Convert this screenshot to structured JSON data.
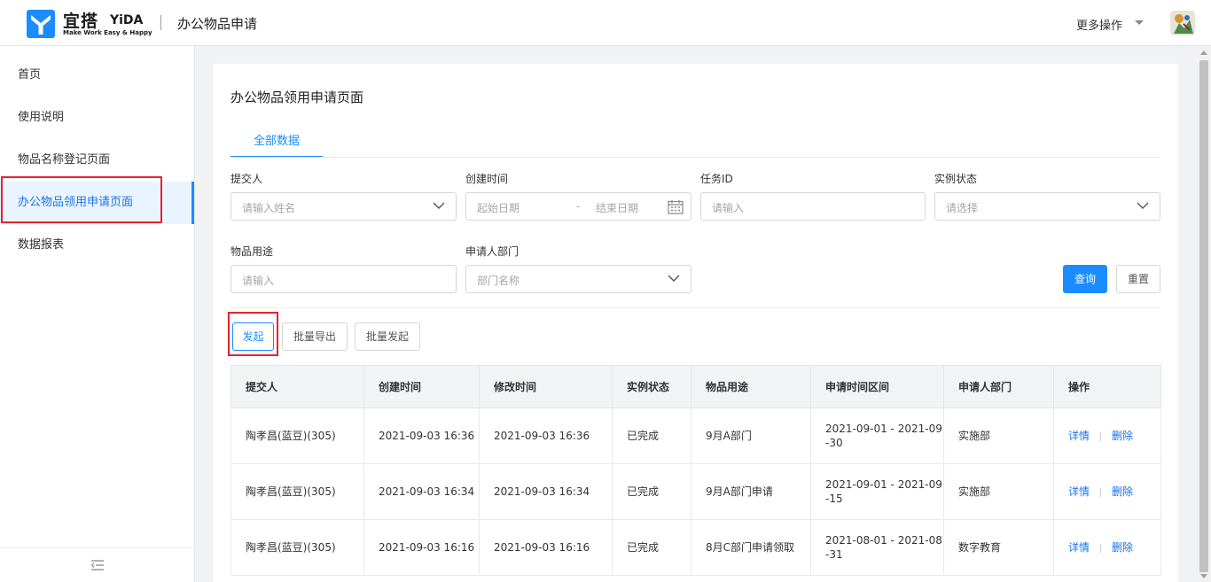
{
  "header": {
    "logo_cn": "宜搭",
    "logo_en": "YiDA",
    "logo_sub": "Make Work Easy & Happy",
    "app_title": "办公物品申请",
    "more_ops": "更多操作"
  },
  "sidebar": {
    "items": [
      {
        "label": "首页"
      },
      {
        "label": "使用说明"
      },
      {
        "label": "物品名称登记页面"
      },
      {
        "label": "办公物品领用申请页面"
      },
      {
        "label": "数据报表"
      }
    ]
  },
  "main": {
    "page_title": "办公物品领用申请页面",
    "tab_all": "全部数据"
  },
  "filters": {
    "submitter": {
      "label": "提交人",
      "placeholder": "请输入姓名"
    },
    "created": {
      "label": "创建时间",
      "start": "起始日期",
      "dash": "-",
      "end": "结束日期"
    },
    "task_id": {
      "label": "任务ID",
      "placeholder": "请输入"
    },
    "status": {
      "label": "实例状态",
      "placeholder": "请选择"
    },
    "purpose": {
      "label": "物品用途",
      "placeholder": "请输入"
    },
    "dept": {
      "label": "申请人部门",
      "placeholder": "部门名称"
    },
    "query_btn": "查询",
    "reset_btn": "重置"
  },
  "actions": {
    "launch": "发起",
    "batch_export": "批量导出",
    "batch_launch": "批量发起"
  },
  "table": {
    "headers": [
      "提交人",
      "创建时间",
      "修改时间",
      "实例状态",
      "物品用途",
      "申请时间区间",
      "申请人部门",
      "操作"
    ],
    "rows": [
      {
        "submitter": "陶孝昌(蓝豆)(305)",
        "created": "2021-09-03 16:36",
        "modified": "2021-09-03 16:36",
        "status": "已完成",
        "purpose": "9月A部门",
        "range_1": "2021-09-01 - 2021-09",
        "range_2": "-30",
        "dept": "实施部"
      },
      {
        "submitter": "陶孝昌(蓝豆)(305)",
        "created": "2021-09-03 16:34",
        "modified": "2021-09-03 16:34",
        "status": "已完成",
        "purpose": "9月A部门申请",
        "range_1": "2021-09-01 - 2021-09",
        "range_2": "-15",
        "dept": "实施部"
      },
      {
        "submitter": "陶孝昌(蓝豆)(305)",
        "created": "2021-09-03 16:16",
        "modified": "2021-09-03 16:16",
        "status": "已完成",
        "purpose": "8月C部门申请领取",
        "range_1": "2021-08-01 - 2021-08",
        "range_2": "-31",
        "dept": "数字教育"
      }
    ],
    "op_detail": "详情",
    "op_delete": "删除"
  },
  "colors": {
    "primary": "#1a8cff",
    "link": "#1a73e8",
    "highlight_box": "#e8222e"
  }
}
